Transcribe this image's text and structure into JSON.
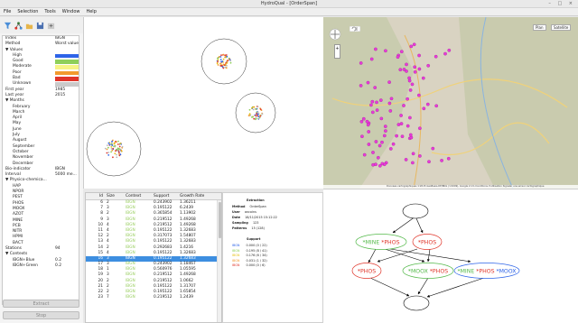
{
  "window": {
    "title": "HydroQual - [OrderSpan]",
    "controls": "– □ ×"
  },
  "menu": [
    "File",
    "Selection",
    "Tools",
    "Window",
    "Help"
  ],
  "toolbar": {
    "icons": [
      "filter-icon",
      "tree-icon",
      "open-icon",
      "save-icon",
      "export-icon"
    ]
  },
  "params": {
    "index": {
      "k": "Index",
      "v": "IBGN"
    },
    "method": {
      "k": "Method",
      "v": "Worst value"
    },
    "values_header": "▼ Values",
    "values": [
      {
        "k": "High",
        "color": "#2e64e8"
      },
      {
        "k": "Good",
        "color": "#8fcf5a"
      },
      {
        "k": "Moderate",
        "color": "#f6f486"
      },
      {
        "k": "Poor",
        "color": "#f29a2e"
      },
      {
        "k": "Bad",
        "color": "#e0352a"
      },
      {
        "k": "Unknown",
        "color": "#cacaca"
      }
    ],
    "first_year": {
      "k": "First year",
      "v": "1985"
    },
    "last_year": {
      "k": "Last year",
      "v": "2015"
    },
    "months_header": "▼ Months",
    "months": [
      "February",
      "March",
      "April",
      "May",
      "June",
      "July",
      "August",
      "September",
      "October",
      "November",
      "December"
    ],
    "bio_indicator": {
      "k": "Bio-indicator",
      "v": "IBGN"
    },
    "interval": {
      "k": "Interval",
      "v": "5000 me..."
    },
    "physico_header": "▼ Physico-chemica...",
    "physico": [
      "HAP",
      "NPOR",
      "PEST",
      "PHOS",
      "MOOX",
      "AZOT",
      "MINE",
      "PCB",
      "NITR",
      "HPMI",
      "BACT"
    ],
    "stations": {
      "k": "Stations",
      "v": "94"
    },
    "contexts_header": "▼ Contexts",
    "contexts": [
      {
        "k": "IBGN+Blue",
        "v": "0.2"
      },
      {
        "k": "IBGN+Green",
        "v": "0.2"
      }
    ]
  },
  "buttons": {
    "extract": "Extract",
    "stop": "Stop"
  },
  "map": {
    "tab_plan": "Plan",
    "tab_satellite": "Satellite",
    "attribution": "Données cartographiques ©2015 GeoBasis-DE/BKG (©2009), Google   2 km   Conditions d'utilisation   Signaler une erreur cartographique"
  },
  "table": {
    "headers": [
      "Id",
      "Size",
      "Context",
      "Support",
      "Growth Rate"
    ],
    "selected_index": 10,
    "rows": [
      [
        "6",
        "2",
        "IBGN",
        "0.243902",
        "1.36211"
      ],
      [
        "7",
        "3",
        "IBGN",
        "0.195122",
        "6.2439"
      ],
      [
        "8",
        "2",
        "IBGN",
        "0.365854",
        "1.13902"
      ],
      [
        "9",
        "3",
        "IBGN",
        "0.219512",
        "1.49268"
      ],
      [
        "10",
        "4",
        "IBGN",
        "0.219512",
        "1.49268"
      ],
      [
        "11",
        "4",
        "IBGN",
        "0.195122",
        "1.32683"
      ],
      [
        "12",
        "2",
        "IBGN",
        "0.317073",
        "1.54807"
      ],
      [
        "13",
        "4",
        "IBGN",
        "0.195122",
        "1.32683"
      ],
      [
        "14",
        "2",
        "IBGN",
        "0.292683",
        "1.4216"
      ],
      [
        "15",
        "4",
        "IBGN",
        "0.195122",
        "1.32683"
      ],
      [
        "16",
        "3",
        "IBGN",
        "0.195122",
        "1.32683"
      ],
      [
        "17",
        "3",
        "IBGN",
        "0.243902",
        "1.18467"
      ],
      [
        "18",
        "1",
        "IBGN",
        "0.560976",
        "1.05595"
      ],
      [
        "19",
        "3",
        "IBGN",
        "0.219512",
        "1.49268"
      ],
      [
        "20",
        "2",
        "IBGN",
        "0.219512",
        "1.0662"
      ],
      [
        "21",
        "2",
        "IBGN",
        "0.195122",
        "1.31707"
      ],
      [
        "22",
        "2",
        "IBGN",
        "0.195122",
        "1.65854"
      ],
      [
        "23",
        "7",
        "IBGN",
        "0.219512",
        "1.2439"
      ]
    ]
  },
  "details": {
    "title": "Extraction",
    "rows": [
      {
        "k": "Method",
        "v": "OrderSpan"
      },
      {
        "k": "User",
        "v": "ancoins"
      },
      {
        "k": "Date",
        "v": "18/11/2015 15:12:22"
      },
      {
        "k": "Sampling",
        "v": "123"
      },
      {
        "k": "Patterns",
        "v": "15 (128)"
      }
    ],
    "support_title": "Support",
    "support": [
      {
        "k": "IBGN",
        "v": "0.000 (0 / 22)",
        "color": "#2e64e8"
      },
      {
        "k": "IBGN",
        "v": "0.195 (8 / 41)",
        "color": "#8fcf5a"
      },
      {
        "k": "IBGN",
        "v": "0.176 (6 / 34)",
        "color": "#e6c21a"
      },
      {
        "k": "IBGN",
        "v": "0.031 (1 / 32)",
        "color": "#f29a2e"
      },
      {
        "k": "IBGN",
        "v": "0.000 (0 / 6)",
        "color": "#e0352a"
      }
    ]
  },
  "graph": {
    "nodes": [
      {
        "id": "root",
        "parts": []
      },
      {
        "id": "n1",
        "parts": [
          {
            "t": "*MINE",
            "c": "#54b94a"
          },
          {
            "t": " *PHOS",
            "c": "#e0352a"
          }
        ]
      },
      {
        "id": "n2",
        "parts": [
          {
            "t": "*PHOS",
            "c": "#e0352a"
          }
        ]
      },
      {
        "id": "n3",
        "parts": [
          {
            "t": "*PHOS",
            "c": "#e0352a"
          }
        ]
      },
      {
        "id": "n4",
        "parts": [
          {
            "t": "*MOOX",
            "c": "#54b94a"
          },
          {
            "t": " *PHOS",
            "c": "#e0352a"
          }
        ]
      },
      {
        "id": "n5",
        "parts": [
          {
            "t": "*MINE",
            "c": "#54b94a"
          },
          {
            "t": " *PHOS",
            "c": "#e0352a"
          },
          {
            "t": " *MOOX",
            "c": "#2e64e8"
          }
        ]
      },
      {
        "id": "leaf",
        "parts": []
      }
    ]
  }
}
